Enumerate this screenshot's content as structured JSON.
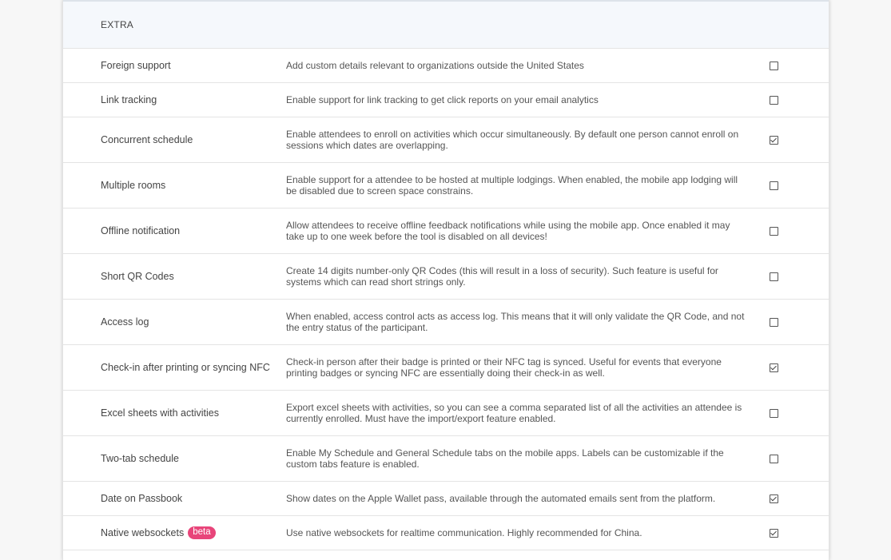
{
  "section": {
    "title": "EXTRA"
  },
  "rows": [
    {
      "name": "Foreign support",
      "description": "Add custom details relevant to organizations outside the United States",
      "checked": false
    },
    {
      "name": "Link tracking",
      "description": "Enable support for link tracking to get click reports on your email analytics",
      "checked": false
    },
    {
      "name": "Concurrent schedule",
      "description": "Enable attendees to enroll on activities which occur simultaneously. By default one person cannot enroll on sessions which dates are overlapping.",
      "checked": true
    },
    {
      "name": "Multiple rooms",
      "description": "Enable support for a attendee to be hosted at multiple lodgings. When enabled, the mobile app lodging will be disabled due to screen space constrains.",
      "checked": false
    },
    {
      "name": "Offline notification",
      "description": "Allow attendees to receive offline feedback notifications while using the mobile app. Once enabled it may take up to one week before the tool is disabled on all devices!",
      "checked": false
    },
    {
      "name": "Short QR Codes",
      "description": "Create 14 digits number-only QR Codes (this will result in a loss of security). Such feature is useful for systems which can read short strings only.",
      "checked": false
    },
    {
      "name": "Access log",
      "description": "When enabled, access control acts as access log. This means that it will only validate the QR Code, and not the entry status of the participant.",
      "checked": false
    },
    {
      "name": "Check-in after printing or syncing NFC",
      "description": "Check-in person after their badge is printed or their NFC tag is synced. Useful for events that everyone printing badges or syncing NFC are essentially doing their check-in as well.",
      "checked": true
    },
    {
      "name": "Excel sheets with activities",
      "description": "Export excel sheets with activities, so you can see a comma separated list of all the activities an attendee is currently enrolled. Must have the import/export feature enabled.",
      "checked": false
    },
    {
      "name": "Two-tab schedule",
      "description": "Enable My Schedule and General Schedule tabs on the mobile apps. Labels can be customizable if the custom tabs feature is enabled.",
      "checked": false
    },
    {
      "name": "Date on Passbook",
      "description": "Show dates on the Apple Wallet pass, available through the automated emails sent from the platform.",
      "checked": true
    },
    {
      "name": "Native websockets",
      "badge": "beta",
      "description": "Use native websockets for realtime communication. Highly recommended for China.",
      "checked": true
    }
  ],
  "colors": {
    "badge": "#e8457a",
    "header_bg": "#f5f8fc"
  }
}
